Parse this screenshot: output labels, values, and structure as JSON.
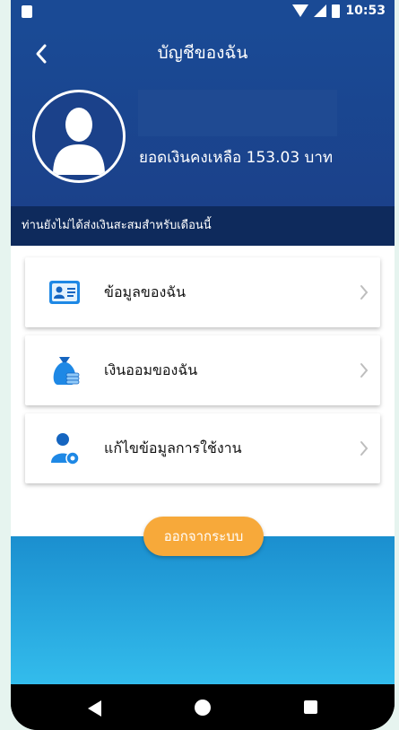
{
  "status": {
    "time": "10:53"
  },
  "header": {
    "title": "บัญชีของฉัน",
    "balance": "ยอดเงินคงเหลือ 153.03 บาท"
  },
  "notice": "ท่านยังไม่ได้ส่งเงินสะสมสำหรับเดือนนี้",
  "menu": {
    "items": [
      {
        "label": "ข้อมูลของฉัน",
        "icon": "id-card-icon"
      },
      {
        "label": "เงินออมของฉัน",
        "icon": "money-bag-icon"
      },
      {
        "label": "แก้ไขข้อมูลการใช้งาน",
        "icon": "user-settings-icon"
      }
    ]
  },
  "logout_label": "ออกจากระบบ",
  "colors": {
    "header": "#1a4a95",
    "notice": "#0e2a5c",
    "accent": "#f7a93a",
    "bottom": "#33bcec"
  }
}
